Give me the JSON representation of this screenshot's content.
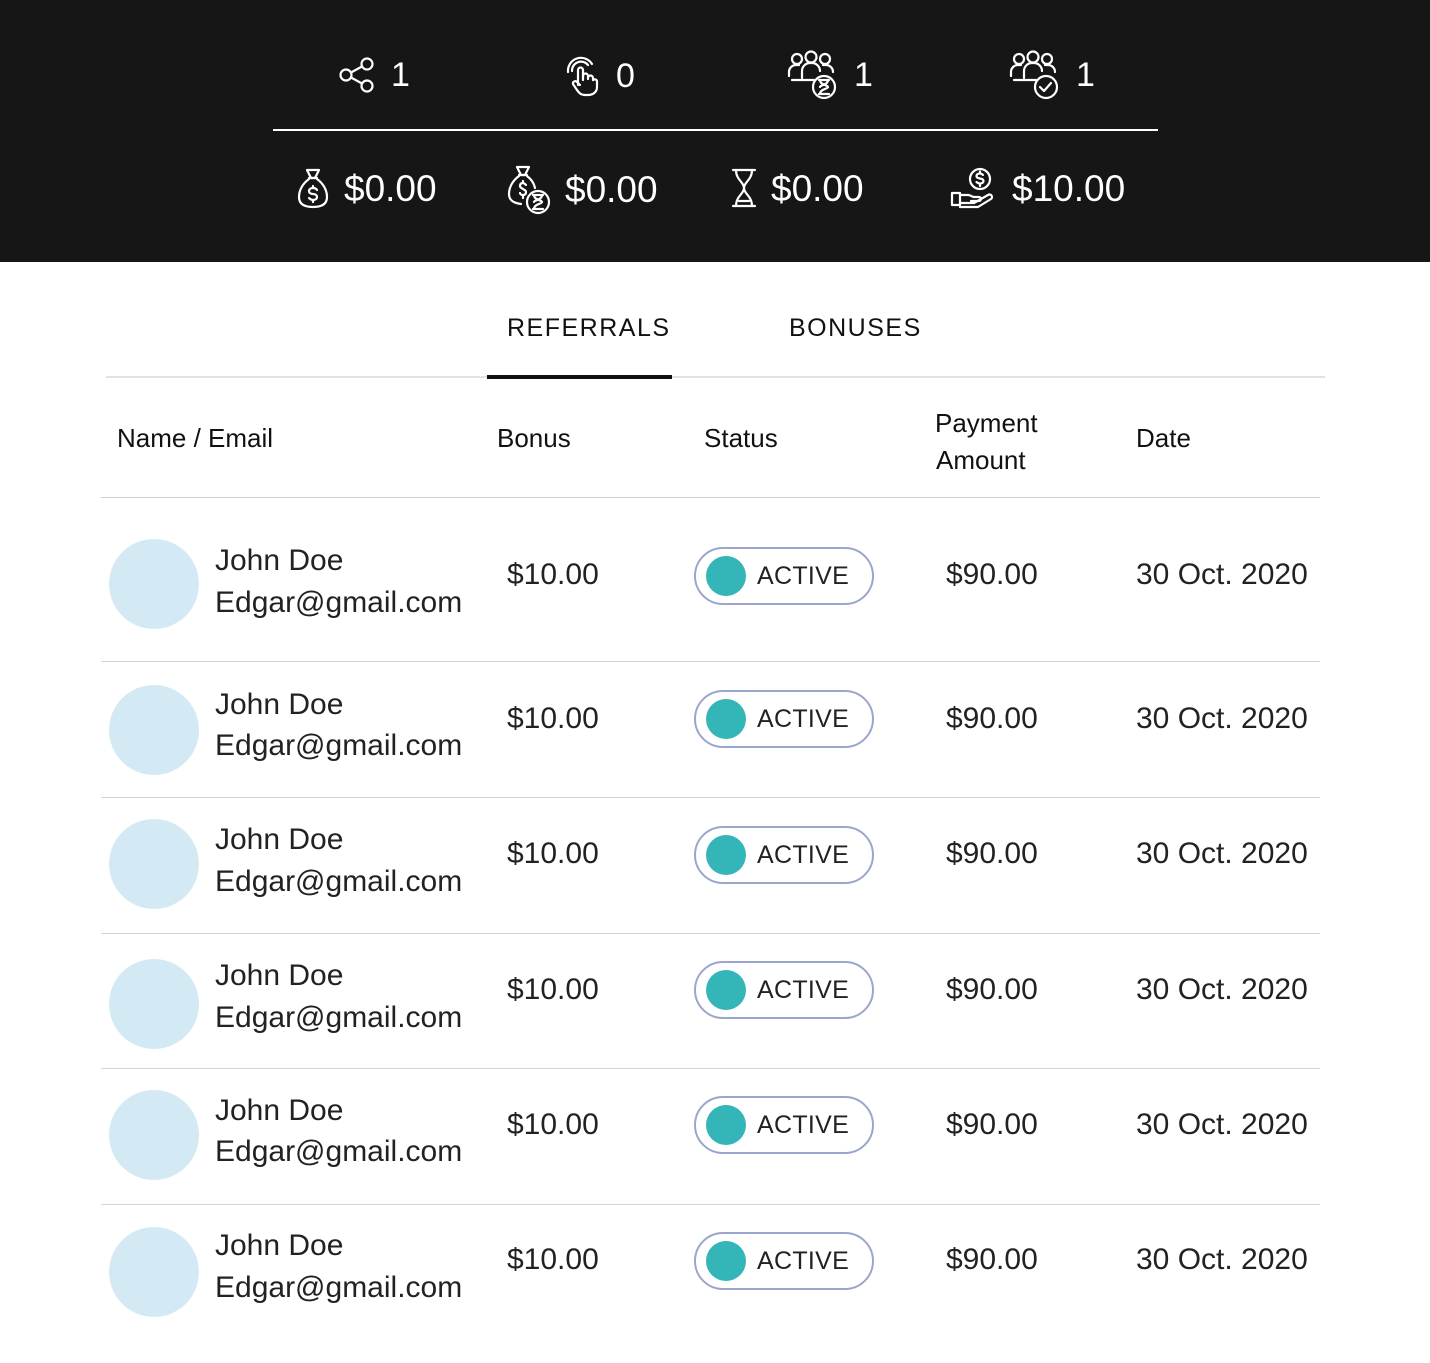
{
  "stats": {
    "top": [
      {
        "icon": "share-icon",
        "value": "1"
      },
      {
        "icon": "tap-icon",
        "value": "0"
      },
      {
        "icon": "users-pending-icon",
        "value": "1"
      },
      {
        "icon": "users-approved-icon",
        "value": "1"
      }
    ],
    "bottom": [
      {
        "icon": "money-bag-icon",
        "value": "$0.00"
      },
      {
        "icon": "money-bag-pending-icon",
        "value": "$0.00"
      },
      {
        "icon": "hourglass-icon",
        "value": "$0.00"
      },
      {
        "icon": "hand-coin-icon",
        "value": "$10.00"
      }
    ]
  },
  "tabs": [
    {
      "label": "REFERRALS",
      "active": true
    },
    {
      "label": "BONUSES",
      "active": false
    }
  ],
  "table": {
    "headers": {
      "name": "Name / Email",
      "bonus": "Bonus",
      "status": "Status",
      "payment_line1": "Payment",
      "payment_line2": "Amount",
      "date": "Date"
    },
    "rows": [
      {
        "name": "John Doe",
        "email": "Edgar@gmail.com",
        "bonus": "$10.00",
        "status": "ACTIVE",
        "payment": "$90.00",
        "date": "30 Oct. 2020"
      },
      {
        "name": "John Doe",
        "email": "Edgar@gmail.com",
        "bonus": "$10.00",
        "status": "ACTIVE",
        "payment": "$90.00",
        "date": "30 Oct. 2020"
      },
      {
        "name": "John Doe",
        "email": "Edgar@gmail.com",
        "bonus": "$10.00",
        "status": "ACTIVE",
        "payment": "$90.00",
        "date": "30 Oct. 2020"
      },
      {
        "name": "John Doe",
        "email": "Edgar@gmail.com",
        "bonus": "$10.00",
        "status": "ACTIVE",
        "payment": "$90.00",
        "date": "30 Oct. 2020"
      },
      {
        "name": "John Doe",
        "email": "Edgar@gmail.com",
        "bonus": "$10.00",
        "status": "ACTIVE",
        "payment": "$90.00",
        "date": "30 Oct. 2020"
      },
      {
        "name": "John Doe",
        "email": "Edgar@gmail.com",
        "bonus": "$10.00",
        "status": "ACTIVE",
        "payment": "$90.00",
        "date": "30 Oct. 2020"
      }
    ]
  },
  "colors": {
    "header_bg": "#161616",
    "status_dot": "#34b5b8",
    "status_border": "#9aa6cd",
    "avatar_bg": "#d3eaf5"
  }
}
